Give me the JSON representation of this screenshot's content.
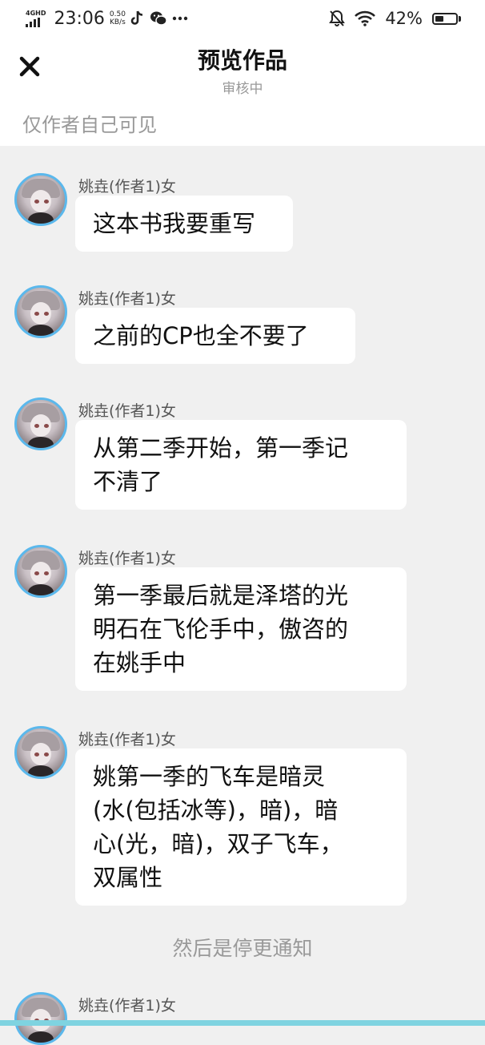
{
  "status_bar": {
    "network": "4GHD",
    "time": "23:06",
    "speed_value": "0.50",
    "speed_unit": "KB/s",
    "battery": "42%",
    "battery_level": 0.42,
    "icons": [
      "signal-icon",
      "tiktok-icon",
      "wechat-icon",
      "more-dots-icon",
      "mute-bell-icon",
      "wifi-icon",
      "battery-icon"
    ]
  },
  "header": {
    "close_icon": "close-icon",
    "title": "预览作品",
    "subtitle": "审核中",
    "visibility_note": "仅作者自己可见"
  },
  "messages": [
    {
      "sender": "姚垚(作者1)女",
      "lines": [
        "这本书我要重写"
      ]
    },
    {
      "sender": "姚垚(作者1)女",
      "lines": [
        "之前的CP也全不要了"
      ]
    },
    {
      "sender": "姚垚(作者1)女",
      "lines": [
        "从第二季开始，第一季记",
        "不清了"
      ]
    },
    {
      "sender": "姚垚(作者1)女",
      "lines": [
        "第一季最后就是泽塔的光",
        "明石在飞伦手中，傲咨的",
        "在姚手中"
      ]
    },
    {
      "sender": "姚垚(作者1)女",
      "lines": [
        "姚第一季的飞车是暗灵",
        "(水(包括冰等)，暗)，暗",
        "心(光，暗)，双子飞车，",
        "双属性"
      ]
    },
    {
      "sender": "姚垚(作者1)女",
      "lines": []
    }
  ],
  "system_notice": "然后是停更通知",
  "colors": {
    "avatar_ring": "#5bb8ec",
    "background": "#f0f0f0",
    "bubble": "#ffffff"
  }
}
